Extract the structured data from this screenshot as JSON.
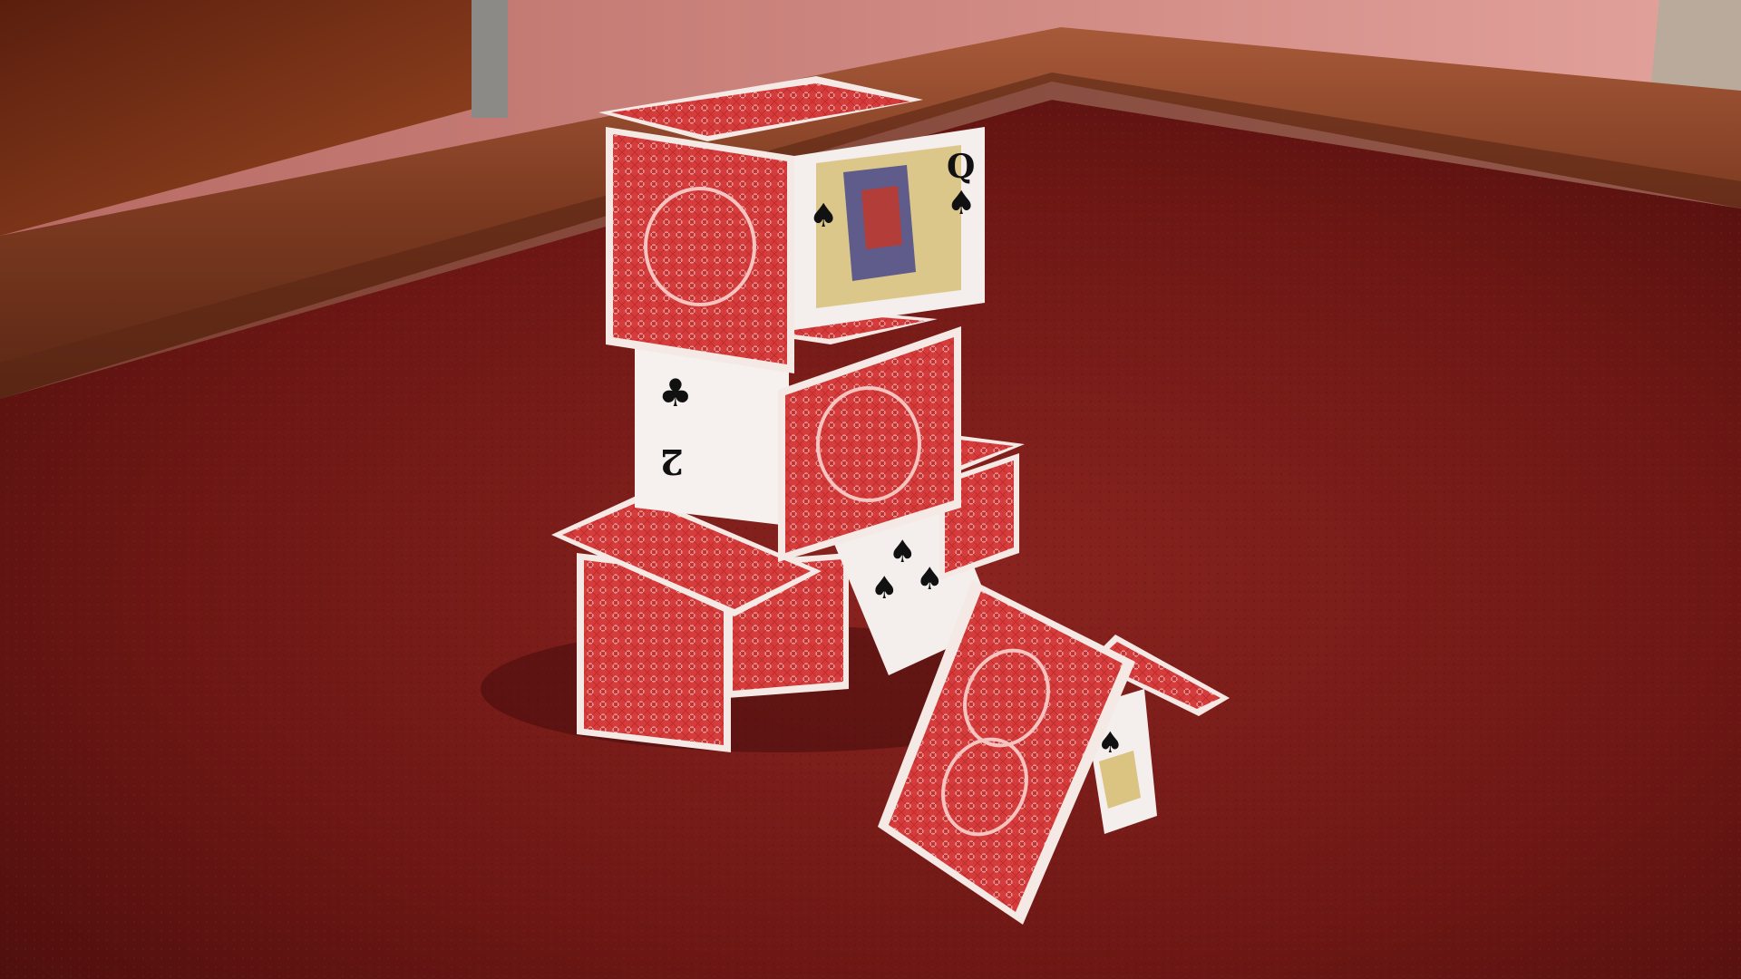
{
  "scene": {
    "title": "",
    "palette": {
      "felt": "#7a1a16",
      "felt_dark": "#4e0f0d",
      "wood": "#7a3a22",
      "wood_light": "#a4583a",
      "wall": "#d08a86",
      "card_back_red": "#d63c3c",
      "card_border": "#f4e9e4",
      "card_face": "#f4eeec"
    },
    "cards": {
      "queen_of_spades": {
        "rank": "Q",
        "suit": "♠"
      },
      "two_of_clubs": {
        "rank": "2",
        "suit": "♣"
      },
      "spades_card": {
        "suit": "♠"
      },
      "jack_of_spades": {
        "suit": "♠"
      }
    }
  }
}
